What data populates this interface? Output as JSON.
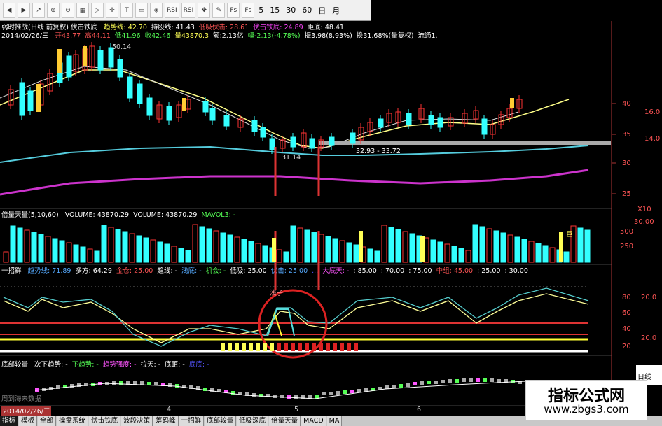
{
  "toolbar": {
    "buttons": [
      "arrow-left-icon",
      "arrow-right-icon",
      "line-chart-icon",
      "zoom-in-icon",
      "zoom-out-icon",
      "grid-icon",
      "play-icon",
      "crosshair-icon",
      "text-icon",
      "ruler-icon",
      "compass-icon",
      "rsi-icon",
      "rsi-icon",
      "move-icon",
      "pen-icon",
      "f-icon",
      "f-icon"
    ],
    "rsi_label": "RSI",
    "fs_label": "Fs",
    "periods": [
      "5",
      "15",
      "30",
      "60",
      "日",
      "月"
    ]
  },
  "main_panel": {
    "line1": {
      "title": "弱时推战(日线 前复权) 伏击铁底",
      "items": [
        {
          "label": "趋势线: 42.70",
          "color": "#ffff55"
        },
        {
          "label": "持股线: 41.43",
          "color": "#ffffff"
        },
        {
          "label": "低吸伏击: 28.61",
          "color": "#ff5555"
        },
        {
          "label": "伏击铁底: 24.89",
          "color": "#ff44ff"
        },
        {
          "label": "距底: 48.41",
          "color": "#ffffff"
        }
      ]
    },
    "line2": {
      "date": "2014/02/26/三",
      "items": [
        {
          "label": "开43.77",
          "color": "#ff5555"
        },
        {
          "label": "高44.11",
          "color": "#ff5555"
        },
        {
          "label": "低41.96",
          "color": "#55ff55"
        },
        {
          "label": "收42.46",
          "color": "#55ff55"
        },
        {
          "label": "量43870.3",
          "color": "#ffff55"
        },
        {
          "label": "额:2.13亿",
          "color": "#ffffff"
        },
        {
          "label": "幅-2.13(-4.78%)",
          "color": "#55ff55"
        },
        {
          "label": "振3.98(8.93%)",
          "color": "#ffffff"
        },
        {
          "label": "换31.68%(量复权)",
          "color": "#ffffff"
        },
        {
          "label": "流通1.",
          "color": "#ffffff"
        }
      ]
    },
    "annotations": {
      "high": "50.14",
      "low": "31.14",
      "range": "32.93 - 33.72"
    }
  },
  "volume_panel": {
    "title": "倍量天量(5,10,60)",
    "items": [
      {
        "label": "VOLUME: 43870.29",
        "color": "#ffffff"
      },
      {
        "label": "VOLUME: 43870.29",
        "color": "#ffffff"
      },
      {
        "label": "MAVOL3: -",
        "color": "#55ff55"
      }
    ],
    "badge": "巨"
  },
  "indicator_panel": {
    "title": "一招鲜",
    "items": [
      {
        "label": "趋势线: 71.89",
        "color": "#55aaff"
      },
      {
        "label": "多方: 64.29",
        "color": "#ffffff"
      },
      {
        "label": "金仓: 25.00",
        "color": "#ff5555"
      },
      {
        "label": "趋线: -",
        "color": "#ffffff"
      },
      {
        "label": "浅底: -",
        "color": "#55aaff"
      },
      {
        "label": "机会: -",
        "color": "#55ff55"
      },
      {
        "label": "低吸: 25.00",
        "color": "#ffffff"
      },
      {
        "label": "伏击: 25.00",
        "color": "#55aaff"
      },
      {
        "label": "...",
        "color": "#5555ff"
      },
      {
        "label": "大底天: -",
        "color": "#ff55ff"
      },
      {
        "label": ": 85.00",
        "color": "#ffffff"
      },
      {
        "label": ": 70.00",
        "color": "#ffffff"
      },
      {
        "label": ": 75.00",
        "color": "#ffffff"
      },
      {
        "label": "中组: 45.00",
        "color": "#ff5555"
      },
      {
        "label": ": 25.00",
        "color": "#ffffff"
      },
      {
        "label": ": 30.00",
        "color": "#ffffff"
      }
    ],
    "tag": "浅子"
  },
  "bottom_panel": {
    "title": "底部较量",
    "items": [
      {
        "label": "次下趋势: -",
        "color": "#ffffff"
      },
      {
        "label": "下趋势: -",
        "color": "#55ff55"
      },
      {
        "label": "趋势强度: -",
        "color": "#ff55ff"
      },
      {
        "label": "拉天: -",
        "color": "#ffffff"
      },
      {
        "label": "底距: -",
        "color": "#ffffff"
      },
      {
        "label": "底底: -",
        "color": "#5555ff"
      }
    ],
    "sub": "周到海未数据"
  },
  "right_axis": {
    "price_ticks": [
      "40",
      "35",
      "30",
      "25"
    ],
    "right_ticks": [
      "16.0",
      "14.0"
    ],
    "scale": "X10",
    "vol_ticks": [
      "500",
      "250"
    ],
    "vol_label": "30.00",
    "ind_ticks": [
      "80",
      "60",
      "40",
      "20"
    ],
    "ind_right": [
      "20.0",
      "20.0"
    ],
    "day_label": "日线"
  },
  "timeline": {
    "date": "2014/02/26/三",
    "marks": [
      "4",
      "5",
      "6"
    ]
  },
  "tabs": [
    "指标",
    "模板",
    "全部",
    "操盘系统",
    "伏击铁底",
    "波段决策",
    "筹码峰",
    "一招鲜",
    "底部较量",
    "低吸深底",
    "倍量天量",
    "MACD",
    "MA"
  ],
  "active_tab": "指标",
  "watermark": {
    "title": "指标公式网",
    "url": "www.zbgs3.com"
  },
  "colors": {
    "up": "#ff3333",
    "down": "#33ffff",
    "yellow": "#ffff55",
    "magenta": "#dd33dd",
    "cyan": "#55ccdd"
  }
}
